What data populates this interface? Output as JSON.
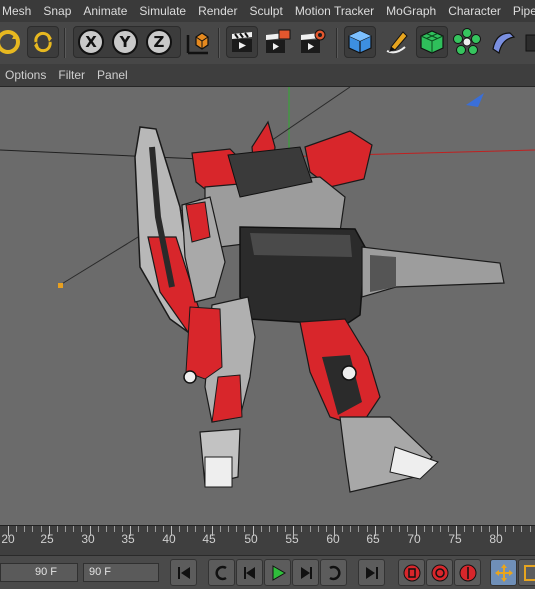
{
  "menubar": {
    "items": [
      "Mesh",
      "Snap",
      "Animate",
      "Simulate",
      "Render",
      "Sculpt",
      "Motion Tracker",
      "MoGraph",
      "Character",
      "Pipeline"
    ]
  },
  "toolbar": {
    "axis_x": "X",
    "axis_y": "Y",
    "axis_z": "Z"
  },
  "viewport_menu": {
    "items": [
      "Options",
      "Filter",
      "Panel"
    ]
  },
  "timeline": {
    "labels": [
      "20",
      "25",
      "30",
      "35",
      "40",
      "45",
      "50",
      "55",
      "60",
      "65",
      "70",
      "75",
      "80"
    ]
  },
  "transport": {
    "frame_field_1": "90 F",
    "frame_field_2": "90 F"
  },
  "colors": {
    "viewport_bg": "#6b6b6b",
    "robot_red": "#d8262b",
    "robot_gray": "#a9a9a9",
    "axis_x_red": "#d02020",
    "axis_y_green": "#2fae2f",
    "accent_blue": "#3a6fd8"
  }
}
